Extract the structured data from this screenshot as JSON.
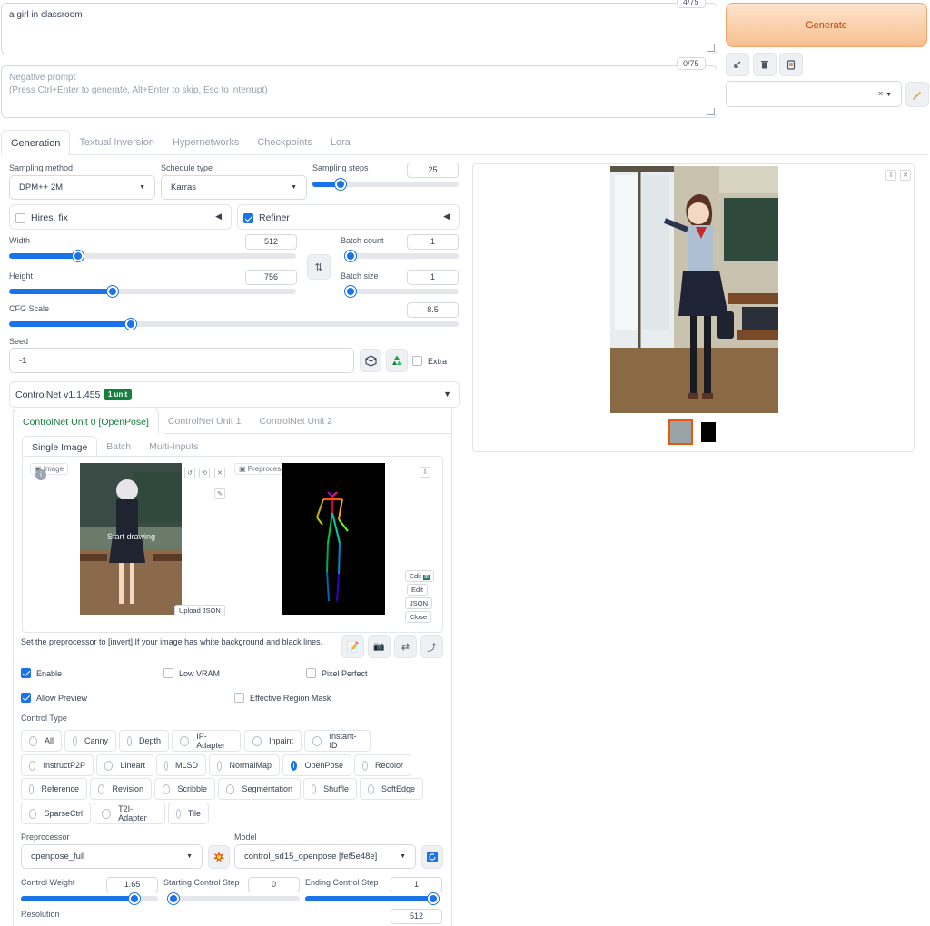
{
  "prompt": {
    "value": "a girl in classroom",
    "counter": "4/75"
  },
  "negative_prompt": {
    "label": "Negative prompt",
    "hint": "(Press Ctrl+Enter to generate, Alt+Enter to skip, Esc to interrupt)",
    "counter": "0/75"
  },
  "generate_label": "Generate",
  "styles_clear": "×",
  "main_tabs": [
    "Generation",
    "Textual Inversion",
    "Hypernetworks",
    "Checkpoints",
    "Lora"
  ],
  "sampling_method": {
    "label": "Sampling method",
    "value": "DPM++ 2M"
  },
  "schedule_type": {
    "label": "Schedule type",
    "value": "Karras"
  },
  "sampling_steps": {
    "label": "Sampling steps",
    "value": "25",
    "fraction": 0.19
  },
  "hires": {
    "label": "Hires. fix",
    "checked": false
  },
  "refiner": {
    "label": "Refiner",
    "checked": true
  },
  "width": {
    "label": "Width",
    "value": "512",
    "fraction": 0.24
  },
  "height": {
    "label": "Height",
    "value": "756",
    "fraction": 0.36
  },
  "batch_count": {
    "label": "Batch count",
    "value": "1",
    "fraction": 0
  },
  "batch_size": {
    "label": "Batch size",
    "value": "1",
    "fraction": 0
  },
  "cfg": {
    "label": "CFG Scale",
    "value": "8.5",
    "fraction": 0.27
  },
  "seed": {
    "label": "Seed",
    "value": "-1",
    "extra": "Extra"
  },
  "controlnet": {
    "title": "ControlNet v1.1.455",
    "badge": "1 unit",
    "unit_tabs": [
      "ControlNet Unit 0 [OpenPose]",
      "ControlNet Unit 1",
      "ControlNet Unit 2"
    ],
    "mode_tabs": [
      "Single Image",
      "Batch",
      "Multi-Inputs"
    ],
    "image_label": "Image",
    "preview_label": "Preprocessor Preview",
    "start_drawing": "Start drawing",
    "upload_json": "Upload JSON",
    "edit1": "Edit",
    "edit2": "Edit",
    "json": "JSON",
    "close": "Close",
    "hint": "Set the preprocessor to [invert] If your image has white background and black lines.",
    "enable": "Enable",
    "low_vram": "Low VRAM",
    "pixel_perfect": "Pixel Perfect",
    "allow_preview": "Allow Preview",
    "effective_region_mask": "Effective Region Mask",
    "control_type_label": "Control Type",
    "control_types": [
      [
        "All",
        "Canny",
        "Depth",
        "IP-Adapter",
        "Inpaint",
        "Instant-ID"
      ],
      [
        "InstructP2P",
        "Lineart",
        "MLSD",
        "NormalMap",
        "OpenPose",
        "Recolor"
      ],
      [
        "Reference",
        "Revision",
        "Scribble",
        "Segmentation",
        "Shuffle",
        "SoftEdge"
      ],
      [
        "SparseCtrl",
        "T2I-Adapter",
        "Tile"
      ]
    ],
    "selected_type": "OpenPose",
    "preprocessor": {
      "label": "Preprocessor",
      "value": "openpose_full"
    },
    "model": {
      "label": "Model",
      "value": "control_sd15_openpose [fef5e48e]"
    },
    "control_weight": {
      "label": "Control Weight",
      "value": "1.65",
      "fraction": 0.83
    },
    "start_step": {
      "label": "Starting Control Step",
      "value": "0",
      "fraction": 0
    },
    "end_step": {
      "label": "Ending Control Step",
      "value": "1",
      "fraction": 1
    },
    "resolution": {
      "label": "Resolution",
      "value": "512"
    }
  },
  "colors": {
    "accent": "#1a73e8",
    "generate": "#f8bf8f",
    "controlnet_green": "#15803d"
  }
}
